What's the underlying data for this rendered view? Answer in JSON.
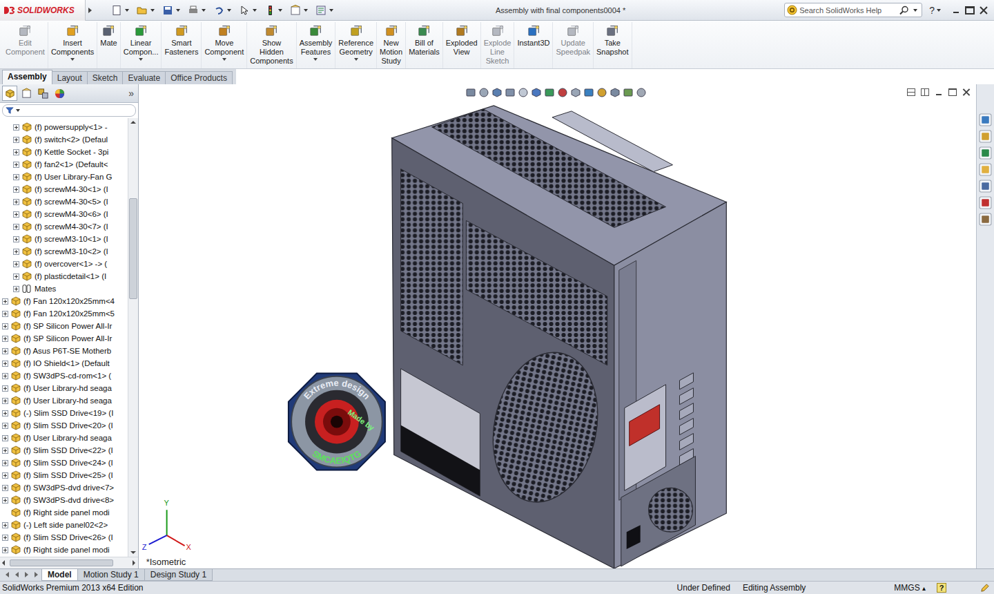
{
  "window": {
    "logo": "SOLIDWORKS",
    "title": "Assembly with final components0004 *",
    "search_placeholder": "Search SolidWorks Help",
    "help": "?"
  },
  "ribbon": [
    {
      "lines": [
        "Edit",
        "Component"
      ],
      "disabled": true,
      "dropdown": false
    },
    {
      "lines": [
        "Insert",
        "Components"
      ],
      "disabled": false,
      "dropdown": true
    },
    {
      "lines": [
        "Mate"
      ],
      "disabled": false,
      "dropdown": false
    },
    {
      "lines": [
        "Linear",
        "Compon..."
      ],
      "disabled": false,
      "dropdown": true
    },
    {
      "lines": [
        "Smart",
        "Fasteners"
      ],
      "disabled": false,
      "dropdown": false
    },
    {
      "lines": [
        "Move",
        "Component"
      ],
      "disabled": false,
      "dropdown": true
    },
    {
      "lines": [
        "Show",
        "Hidden",
        "Components"
      ],
      "disabled": false,
      "dropdown": false
    },
    {
      "lines": [
        "Assembly",
        "Features"
      ],
      "disabled": false,
      "dropdown": true
    },
    {
      "lines": [
        "Reference",
        "Geometry"
      ],
      "disabled": false,
      "dropdown": true
    },
    {
      "lines": [
        "New",
        "Motion",
        "Study"
      ],
      "disabled": false,
      "dropdown": false
    },
    {
      "lines": [
        "Bill of",
        "Materials"
      ],
      "disabled": false,
      "dropdown": false
    },
    {
      "lines": [
        "Exploded",
        "View"
      ],
      "disabled": false,
      "dropdown": false
    },
    {
      "lines": [
        "Explode",
        "Line",
        "Sketch"
      ],
      "disabled": true,
      "dropdown": false
    },
    {
      "lines": [
        "Instant3D"
      ],
      "disabled": false,
      "dropdown": false
    },
    {
      "lines": [
        "Update",
        "Speedpak"
      ],
      "disabled": true,
      "dropdown": false
    },
    {
      "lines": [
        "Take",
        "Snapshot"
      ],
      "disabled": false,
      "dropdown": false
    }
  ],
  "tabs": [
    {
      "label": "Assembly",
      "selected": true
    },
    {
      "label": "Layout",
      "selected": false
    },
    {
      "label": "Sketch",
      "selected": false
    },
    {
      "label": "Evaluate",
      "selected": false
    },
    {
      "label": "Office Products",
      "selected": false
    }
  ],
  "feature_tabs": {
    "more": "»"
  },
  "tree": [
    {
      "text": "(f) powersupply<1> -",
      "level": 2,
      "kind": "part",
      "expandable": true
    },
    {
      "text": "(f) switch<2> (Defaul",
      "level": 2,
      "kind": "part",
      "expandable": true
    },
    {
      "text": "(f) Kettle Socket - 3pi",
      "level": 2,
      "kind": "part",
      "expandable": true
    },
    {
      "text": "(f) fan2<1> (Default<",
      "level": 2,
      "kind": "part",
      "expandable": true
    },
    {
      "text": "(f) User Library-Fan G",
      "level": 2,
      "kind": "part",
      "expandable": true
    },
    {
      "text": "(f) screwM4-30<1> (I",
      "level": 2,
      "kind": "part",
      "expandable": true
    },
    {
      "text": "(f) screwM4-30<5> (I",
      "level": 2,
      "kind": "part",
      "expandable": true
    },
    {
      "text": "(f) screwM4-30<6> (I",
      "level": 2,
      "kind": "part",
      "expandable": true
    },
    {
      "text": "(f) screwM4-30<7> (I",
      "level": 2,
      "kind": "part",
      "expandable": true
    },
    {
      "text": "(f) screwM3-10<1> (I",
      "level": 2,
      "kind": "part",
      "expandable": true
    },
    {
      "text": "(f) screwM3-10<2> (I",
      "level": 2,
      "kind": "part",
      "expandable": true
    },
    {
      "text": "(f) overcover<1> -> (",
      "level": 2,
      "kind": "part",
      "expandable": true
    },
    {
      "text": "(f) plasticdetail<1> (I",
      "level": 2,
      "kind": "part",
      "expandable": true
    },
    {
      "text": "Mates",
      "level": 2,
      "kind": "mates",
      "expandable": true
    },
    {
      "text": "(f) Fan 120x120x25mm<4",
      "level": 1,
      "kind": "part",
      "expandable": true
    },
    {
      "text": "(f) Fan 120x120x25mm<5",
      "level": 1,
      "kind": "part",
      "expandable": true
    },
    {
      "text": "(f) SP Silicon Power All-Ir",
      "level": 1,
      "kind": "part",
      "expandable": true
    },
    {
      "text": "(f) SP Silicon Power All-Ir",
      "level": 1,
      "kind": "part",
      "expandable": true
    },
    {
      "text": "(f) Asus P6T-SE Motherb",
      "level": 1,
      "kind": "part",
      "expandable": true
    },
    {
      "text": "(f) IO Shield<1> (Default",
      "level": 1,
      "kind": "part",
      "expandable": true
    },
    {
      "text": "(f) SW3dPS-cd-rom<1> (",
      "level": 1,
      "kind": "part",
      "expandable": true
    },
    {
      "text": "(f) User Library-hd seaga",
      "level": 1,
      "kind": "part",
      "expandable": true
    },
    {
      "text": "(f) User Library-hd seaga",
      "level": 1,
      "kind": "part",
      "expandable": true
    },
    {
      "text": "(-) Slim SSD Drive<19> (I",
      "level": 1,
      "kind": "part",
      "expandable": true
    },
    {
      "text": "(f) Slim SSD Drive<20> (I",
      "level": 1,
      "kind": "part",
      "expandable": true
    },
    {
      "text": "(f) User Library-hd seaga",
      "level": 1,
      "kind": "part",
      "expandable": true
    },
    {
      "text": "(f) Slim SSD Drive<22> (I",
      "level": 1,
      "kind": "part",
      "expandable": true
    },
    {
      "text": "(f) Slim SSD Drive<24> (I",
      "level": 1,
      "kind": "part",
      "expandable": true
    },
    {
      "text": "(f) Slim SSD Drive<25> (I",
      "level": 1,
      "kind": "part",
      "expandable": true
    },
    {
      "text": "(f) SW3dPS-dvd drive<7>",
      "level": 1,
      "kind": "part",
      "expandable": true
    },
    {
      "text": "(f) SW3dPS-dvd drive<8>",
      "level": 1,
      "kind": "part",
      "expandable": true
    },
    {
      "text": "(f) Right side panel modi",
      "level": 1,
      "kind": "part",
      "expandable": false
    },
    {
      "text": "(-) Left side panel02<2>",
      "level": 1,
      "kind": "part",
      "expandable": true
    },
    {
      "text": "(f) Slim SSD Drive<26> (I",
      "level": 1,
      "kind": "part",
      "expandable": true
    },
    {
      "text": "(f) Right side panel modi",
      "level": 1,
      "kind": "part",
      "expandable": true
    }
  ],
  "scrollbar": {
    "offset": 0.17,
    "size": 0.24
  },
  "viewport": {
    "view_label": "*Isometric",
    "axes": [
      {
        "label": "Y",
        "color": "#1a9a1a"
      },
      {
        "label": "X",
        "color": "#d01818"
      },
      {
        "label": "Z",
        "color": "#1a1ad0"
      }
    ],
    "badge": {
      "top": "Extreme design",
      "middle": "Made by",
      "bottom": "SMCAEIQTG"
    }
  },
  "bottom_tabs": [
    {
      "label": "Model",
      "selected": true
    },
    {
      "label": "Motion Study 1",
      "selected": false
    },
    {
      "label": "Design Study 1",
      "selected": false
    }
  ],
  "status_bar": {
    "edition": "SolidWorks Premium 2013 x64 Edition",
    "state": "Under Defined",
    "mode": "Editing Assembly",
    "units": "MMGS",
    "units_menu": "▴",
    "help": "?"
  }
}
